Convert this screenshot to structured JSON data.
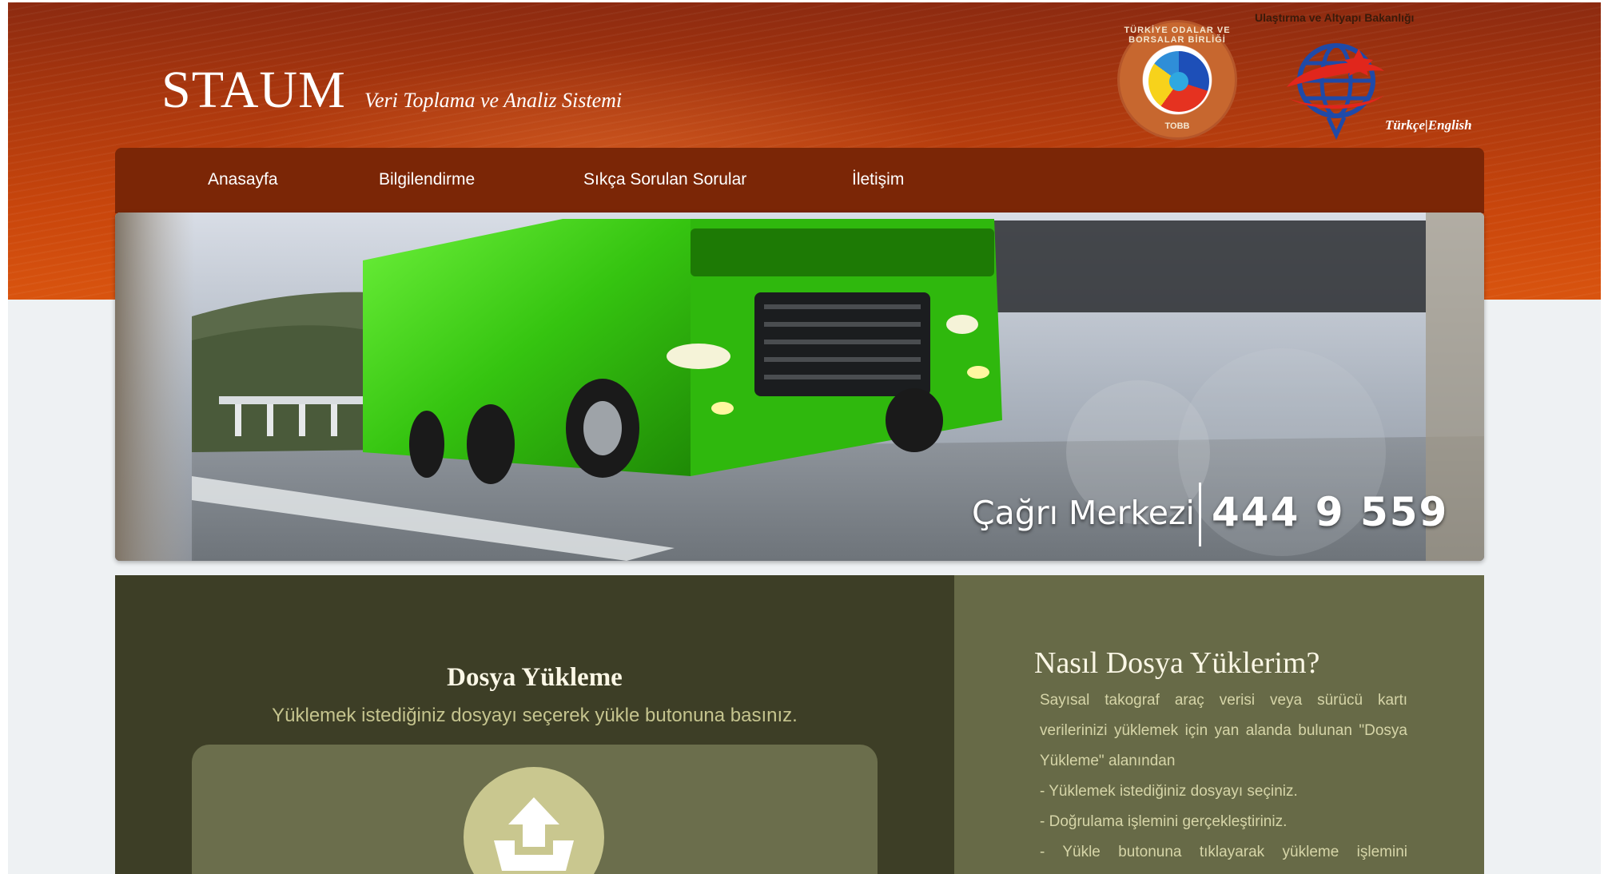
{
  "header": {
    "logo": "STAUM",
    "tagline": "Veri Toplama ve Analiz Sistemi",
    "ministry": "Ulaştırma ve Altyapı Bakanlığı",
    "tobb_ring_top": "TÜRKİYE ODALAR VE BORSALAR BİRLİĞİ",
    "tobb_ring_bottom": "TOBB",
    "lang_tr": "Türkçe",
    "lang_sep": "|",
    "lang_en": "English"
  },
  "nav": {
    "items": [
      {
        "label": "Anasayfa"
      },
      {
        "label": "Bilgilendirme"
      },
      {
        "label": "Sıkça Sorulan Sorular"
      },
      {
        "label": "İletişim"
      }
    ]
  },
  "banner": {
    "callcenter_label": "Çağrı Merkezi",
    "phone": "444 9 559"
  },
  "upload": {
    "title": "Dosya Yükleme",
    "subtitle": "Yüklemek istediğiniz dosyayı seçerek yükle butonuna basınız.",
    "icon": "upload-icon"
  },
  "howto": {
    "title": "Nasıl Dosya Yüklerim?",
    "intro": "Sayısal takograf araç verisi veya sürücü kartı verilerinizi yüklemek için yan alanda bulunan \"Dosya Yükleme\" alanından",
    "steps": [
      "- Yüklemek istediğiniz dosyayı seçiniz.",
      "- Doğrulama işlemini gerçekleştiriniz.",
      "- Yükle butonuna tıklayarak yükleme işlemini tamamlayınız."
    ]
  },
  "colors": {
    "header_orange": "#c9460c",
    "nav_brown": "#7b2606",
    "left_panel": "#3d3e26",
    "right_panel": "#676a47",
    "truck_green": "#3fd014"
  }
}
